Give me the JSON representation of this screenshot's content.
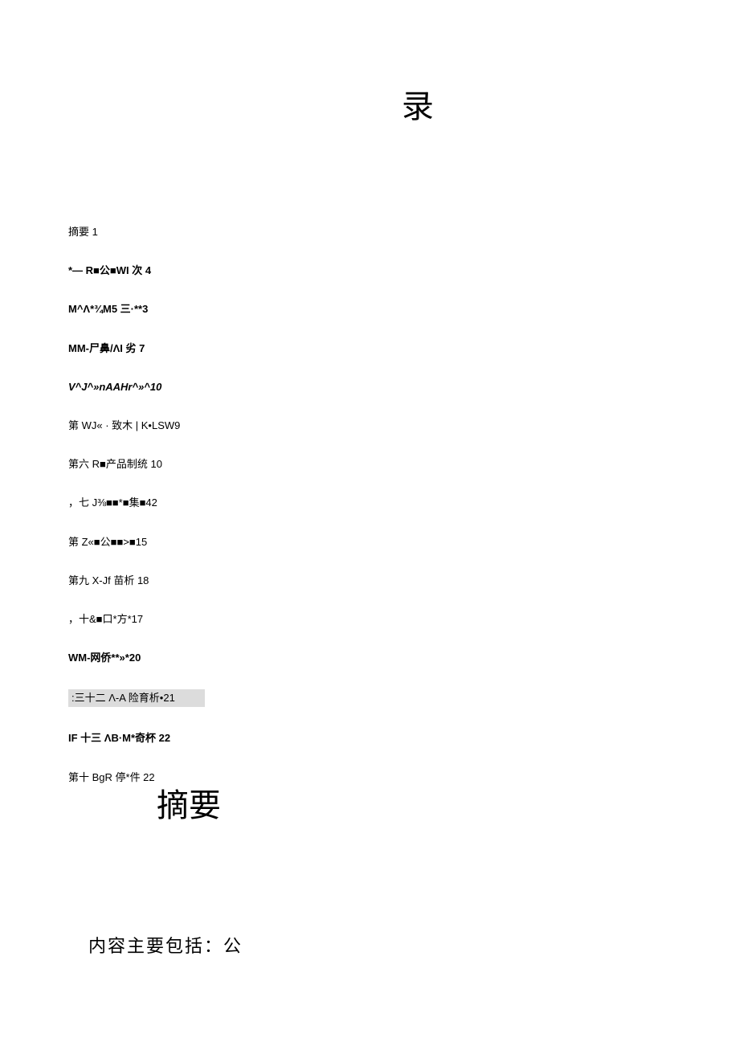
{
  "title": "录",
  "toc": [
    {
      "text": "摘要 1",
      "style": "normal"
    },
    {
      "text": "*— R■公■WI 次 4",
      "style": "bold"
    },
    {
      "text": "M^Λ*¾M5 三·**3",
      "style": "bold"
    },
    {
      "text": "MM-尸鼻/ΛI 劣 7",
      "style": "bold"
    },
    {
      "text": "V^J^»nAAHr^»^10",
      "style": "italic"
    },
    {
      "text": "第 WJ« · 致木 | K•LSW9",
      "style": "normal"
    },
    {
      "text": "第六 R■产品制统 10",
      "style": "normal"
    },
    {
      "text": "，七 J⅜■■*■集■42",
      "style": "normal"
    },
    {
      "text": "第 Z«■公■■>■15",
      "style": "normal"
    },
    {
      "text": "第九 X-Jf 苗析 18",
      "style": "normal"
    },
    {
      "text": "，十&■口*方*17",
      "style": "normal"
    },
    {
      "text": "WM-网侨**»*20",
      "style": "bold"
    },
    {
      "text": ":三十二 Λ-A 险育析•21",
      "style": "highlighted"
    },
    {
      "text": "IF 十三 ΛB·M*奇杯 22",
      "style": "bold"
    },
    {
      "text": "第十 BgR 停*件 22",
      "style": "normal"
    }
  ],
  "section_heading": "摘要",
  "body_paragraph": "内容主要包括：公"
}
